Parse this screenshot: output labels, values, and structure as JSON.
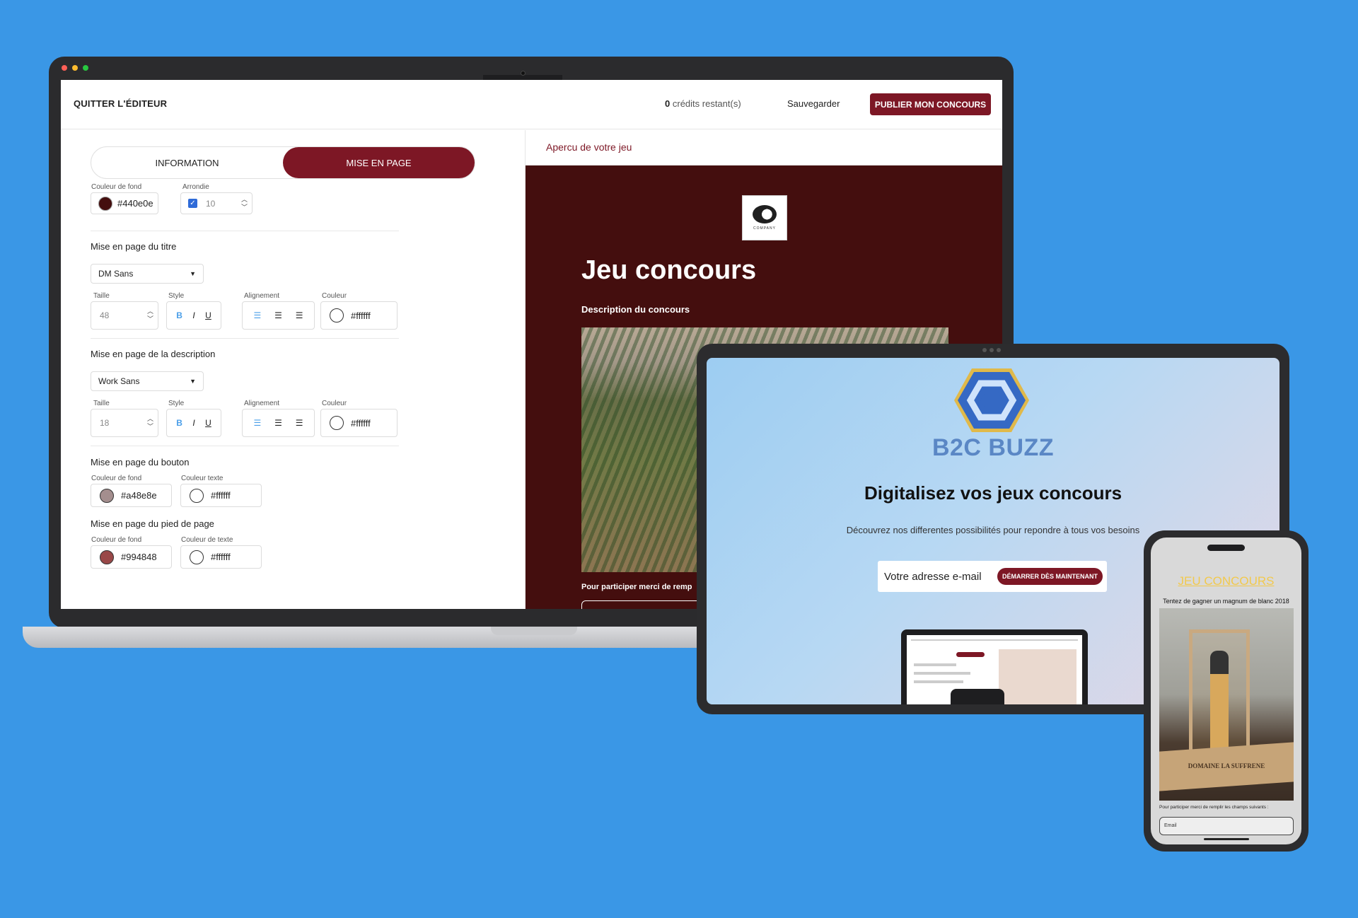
{
  "editor": {
    "quit_label": "QUITTER L'ÉDITEUR",
    "credits_count": "0",
    "credits_label": "crédits restant(s)",
    "save_label": "Sauvegarder",
    "publish_label": "PUBLIER MON CONCOURS",
    "tabs": [
      {
        "label": "INFORMATION",
        "active": false
      },
      {
        "label": "MISE EN PAGE",
        "active": true
      }
    ],
    "background": {
      "color_label": "Couleur de fond",
      "color_value": "#440e0e",
      "rounded_label": "Arrondie",
      "rounded_checked": true,
      "rounded_value": "10"
    },
    "title_section": {
      "heading": "Mise en page du titre",
      "font": "DM Sans",
      "size_label": "Taille",
      "size_value": "48",
      "style_label": "Style",
      "align_label": "Alignement",
      "color_label": "Couleur",
      "color_value": "#ffffff"
    },
    "description_section": {
      "heading": "Mise en page de la description",
      "font": "Work Sans",
      "size_label": "Taille",
      "size_value": "18",
      "style_label": "Style",
      "align_label": "Alignement",
      "color_label": "Couleur",
      "color_value": "#ffffff"
    },
    "button_section": {
      "heading": "Mise en page du bouton",
      "bg_label": "Couleur de fond",
      "bg_value": "#a48e8e",
      "text_label": "Couleur texte",
      "text_value": "#ffffff"
    },
    "footer_section": {
      "heading": "Mise en page du pied de page",
      "bg_label": "Couleur de fond",
      "bg_value": "#994848",
      "text_label": "Couleur de texte",
      "text_value": "#ffffff"
    },
    "style_buttons": [
      "B",
      "I",
      "U"
    ],
    "preview": {
      "heading": "Apercu de votre jeu",
      "logo_text": "COMPANY",
      "title": "Jeu concours",
      "description": "Description du concours",
      "participate_text": "Pour participer merci de remp"
    }
  },
  "tablet": {
    "brand": "B2C BUZZ",
    "tagline": "Digitalisez vos jeux concours",
    "subtagline": "Découvrez nos differentes possibilités pour repondre à tous vos besoins",
    "email_placeholder": "Votre adresse e-mail",
    "start_button": "DÉMARRER DÈS MAINTENANT"
  },
  "phone": {
    "title": "JEU CONCOURS",
    "subtitle": "Tentez de gagner un magnum de blanc 2018",
    "board_text": "DOMAINE  LA SUFFRENE",
    "participate_text": "Pour participer merci de remplir les champs suivants :",
    "email_placeholder": "Email"
  },
  "colors": {
    "accent": "#7d1725",
    "background": "#3a97e6",
    "preview_bg": "#440e0e",
    "brand_blue": "#5a87c5",
    "phone_title": "#f2c94c"
  }
}
